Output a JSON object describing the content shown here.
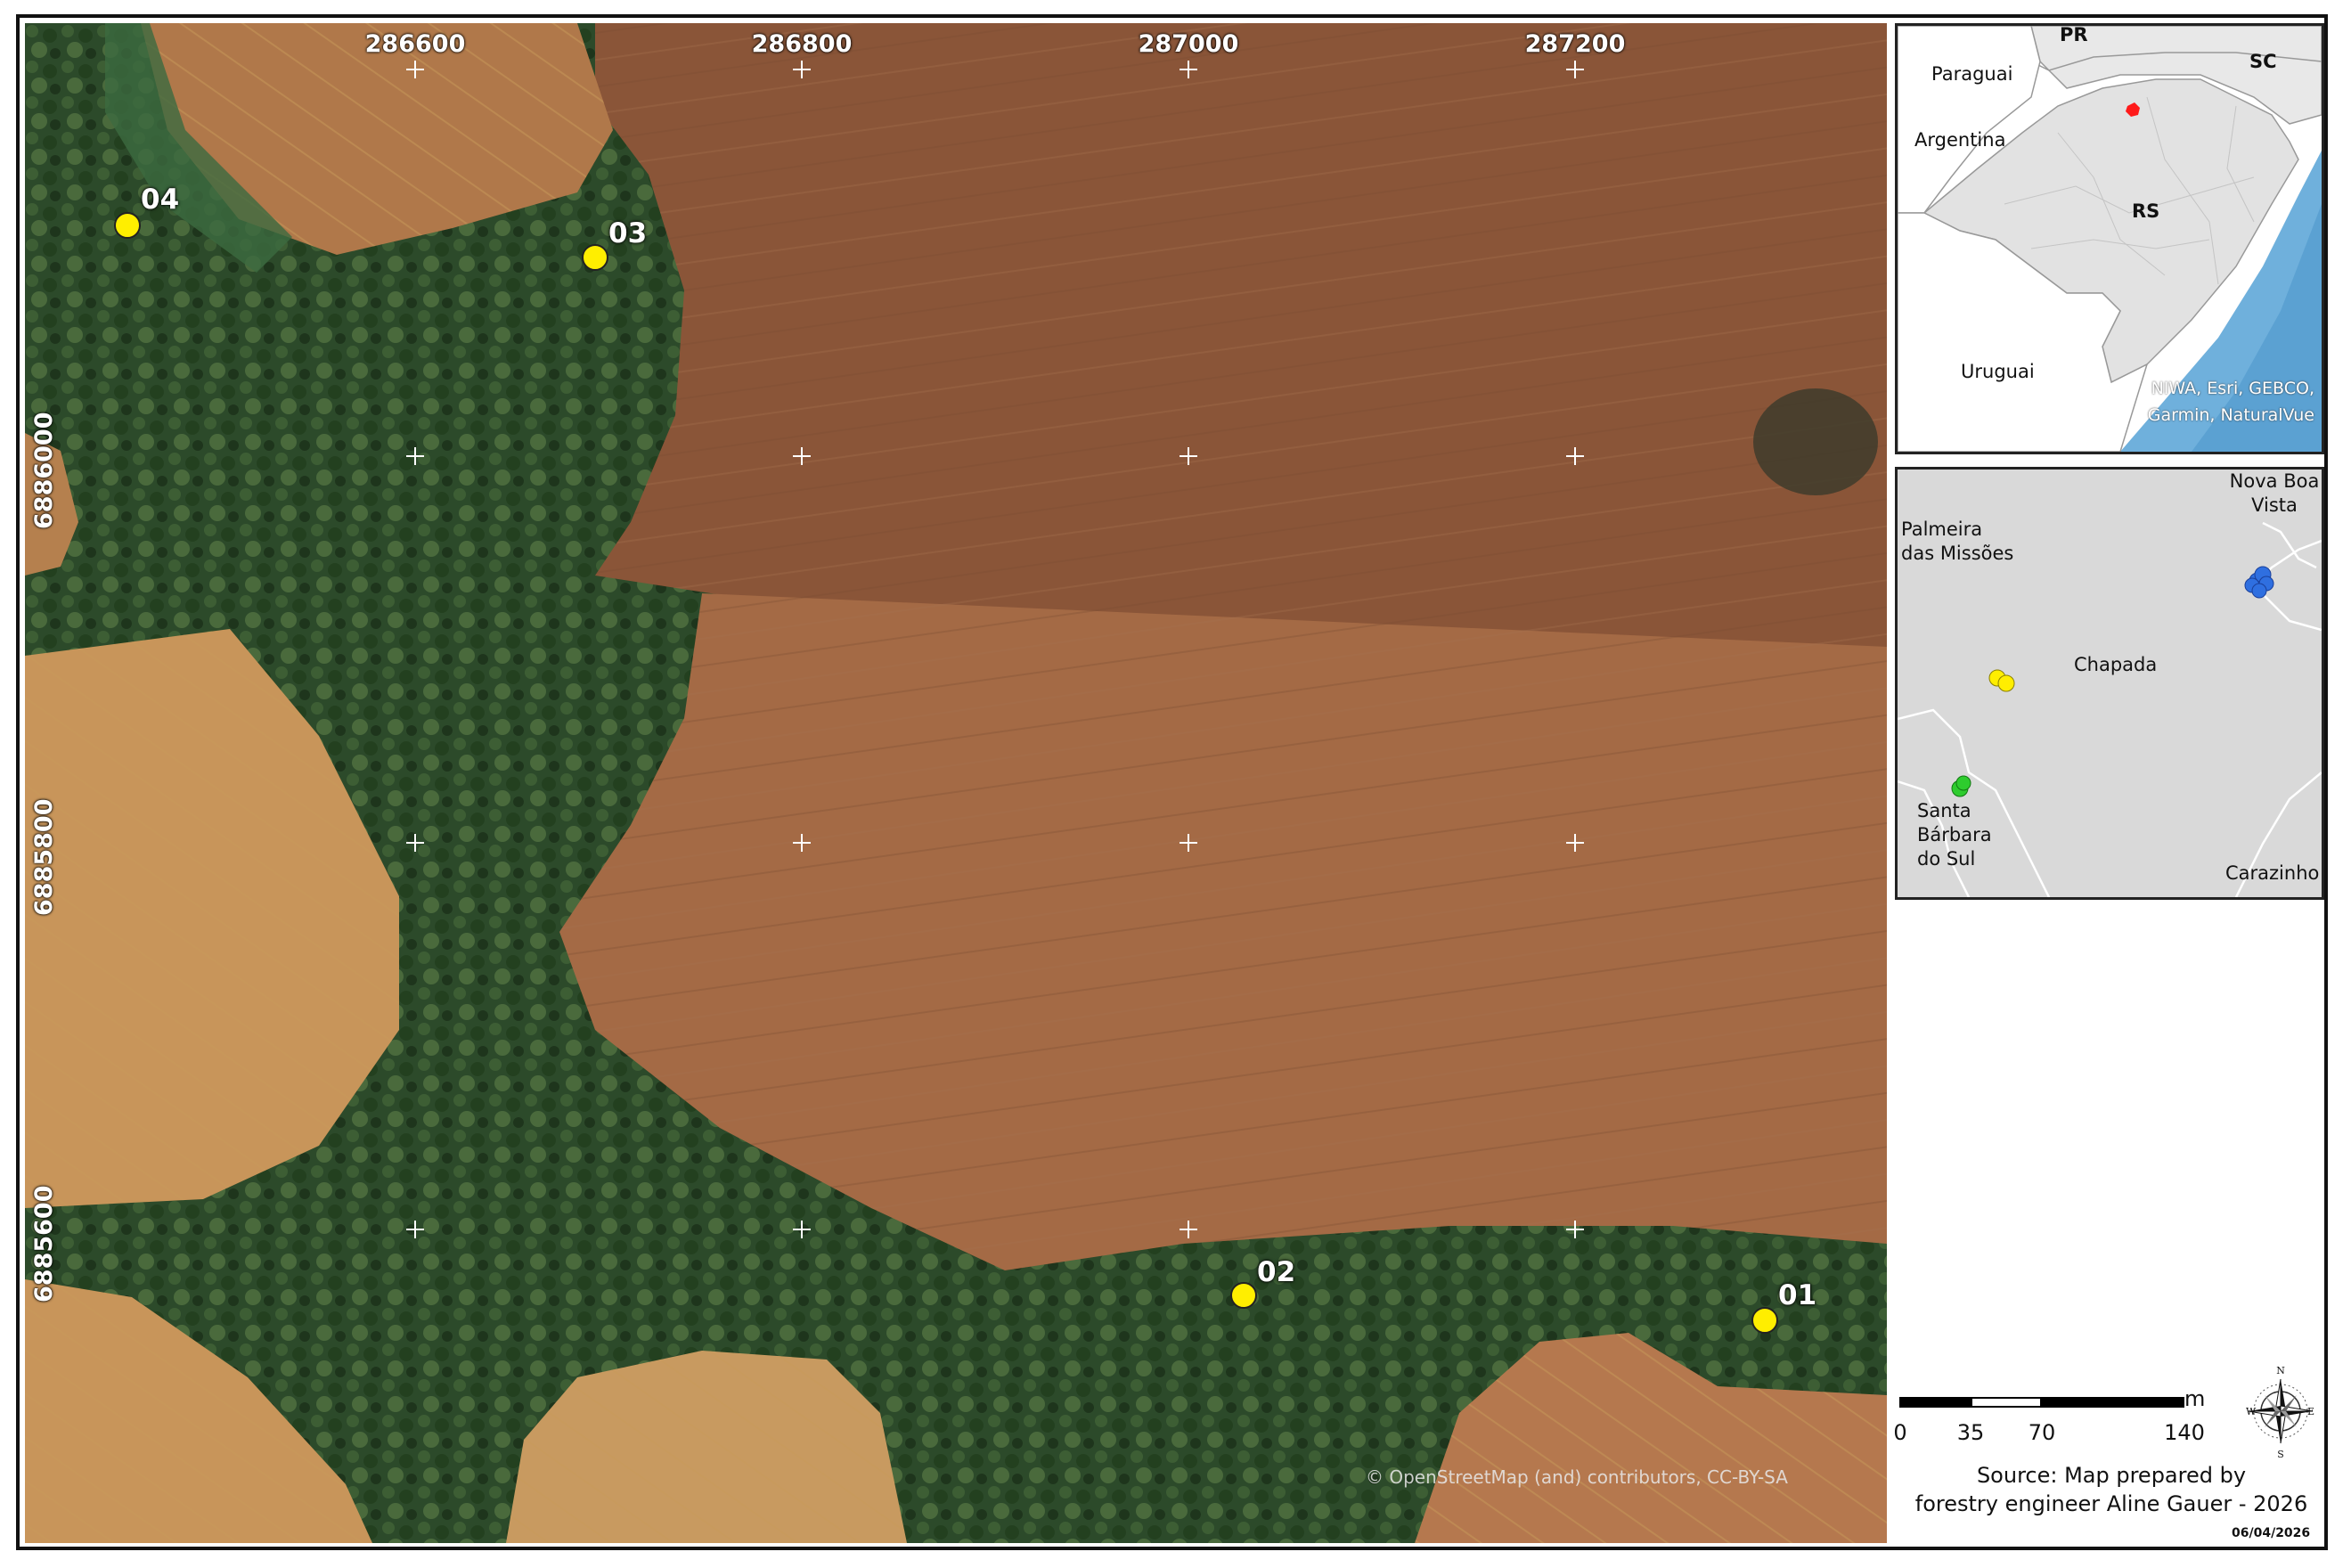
{
  "main_map": {
    "x_coords": [
      "286600",
      "286800",
      "287000",
      "287200"
    ],
    "y_coords": [
      "6886000",
      "6885800",
      "6885600"
    ],
    "points": [
      {
        "label": "04"
      },
      {
        "label": "03"
      },
      {
        "label": "02"
      },
      {
        "label": "01"
      }
    ],
    "credit": "© OpenStreetMap (and) contributors, CC-BY-SA"
  },
  "inset_state": {
    "labels": {
      "pr": "PR",
      "sc": "SC",
      "rs": "RS",
      "paraguai": "Paraguai",
      "argentina": "Argentina",
      "uruguai": "Uruguai"
    },
    "credit_line1": "NIWA, Esri, GEBCO,",
    "credit_line2": "Garmin, NaturalVue",
    "colors": {
      "land": "#e2e2e2",
      "sea": "#6fb0dc",
      "highlight": "#ff1a1a"
    }
  },
  "inset_local": {
    "towns": {
      "nova_boa_vista_1": "Nova Boa",
      "nova_boa_vista_2": "Vista",
      "palmeira_1": "Palmeira",
      "palmeira_2": "das Missões",
      "chapada": "Chapada",
      "santa_barbara_1": "Santa",
      "santa_barbara_2": "Bárbara",
      "santa_barbara_3": "do Sul",
      "carazinho": "Carazinho"
    },
    "colors": {
      "blue_points": "#2f6fe0",
      "yellow_points": "#ffee00",
      "green_points": "#2ecc2e"
    }
  },
  "scale_bar": {
    "unit": "m",
    "ticks": [
      "0",
      "35",
      "70",
      "140"
    ]
  },
  "compass": {
    "n": "N",
    "s": "S",
    "e": "E",
    "w": "W"
  },
  "source": {
    "line1": "Source: Map prepared by",
    "line2": "forestry engineer Aline Gauer - 2026"
  },
  "date": "06/04/2026"
}
